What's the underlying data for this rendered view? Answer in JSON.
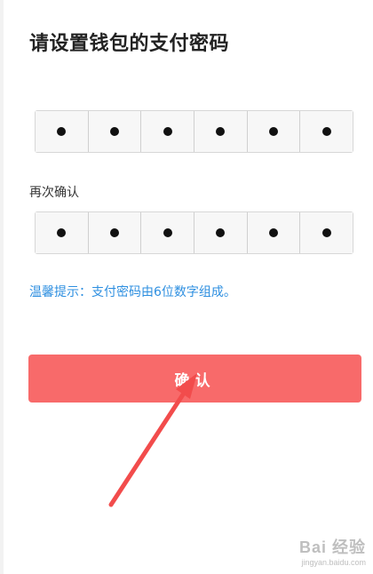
{
  "page_title": "请设置钱包的支付密码",
  "password": {
    "digits": [
      "•",
      "•",
      "•",
      "•",
      "•",
      "•"
    ]
  },
  "confirm": {
    "label": "再次确认",
    "digits": [
      "•",
      "•",
      "•",
      "•",
      "•",
      "•"
    ]
  },
  "hint": "温馨提示：支付密码由6位数字组成。",
  "confirm_button": "确认",
  "colors": {
    "button": "#f86a6a",
    "hint": "#2e8fe0",
    "arrow": "#f24c4c"
  },
  "watermark": {
    "main": "Bai 经验",
    "sub": "jingyan.baidu.com"
  }
}
